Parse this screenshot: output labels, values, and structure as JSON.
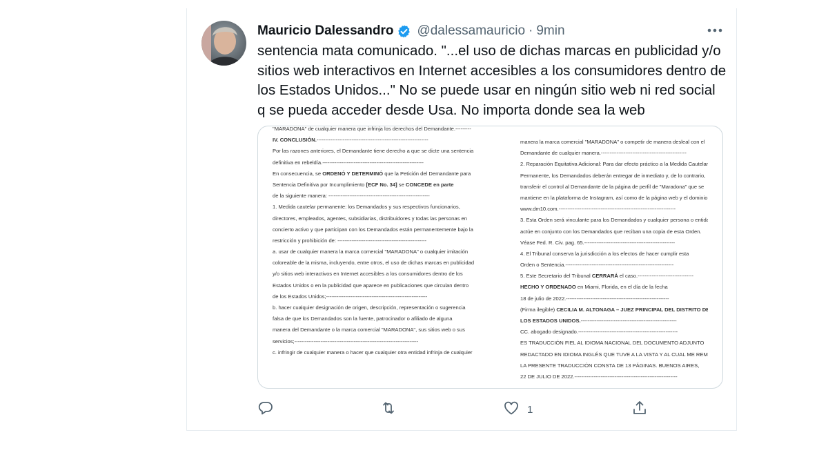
{
  "tweet": {
    "author_name": "Mauricio Dalessandro",
    "handle": "@dalessamauricio",
    "separator": "·",
    "time": "9min",
    "text": "sentencia mata comunicado. \"...el uso de dichas marcas en publicidad y/o sitios web interactivos en Internet accesibles a los consumidores dentro de los Estados Unidos...\" No se puede usar en ningún sitio web ni red social q se pueda acceder desde Usa. No importa donde sea la web",
    "likes": "1"
  },
  "icons": {
    "verified": "verified-badge-icon",
    "more": "more-dots-icon",
    "reply": "reply-icon",
    "retweet": "retweet-icon",
    "like": "heart-icon",
    "share": "share-icon"
  },
  "colors": {
    "verified": "#1d9bf0",
    "muted": "#536471",
    "border": "#cfd9de"
  },
  "document": {
    "left": [
      "\"MARADONA\" de cualquier manera que infrinja los derechos del Demandante.---------",
      "IV. CONCLUSIÓN.----------------------------------------------------------------",
      "Por las razones anteriores, el Demandante tiene derecho a que se dicte una sentencia",
      "definitiva en rebeldía.----------------------------------------------------------",
      "En consecuencia, se ORDENÓ Y DETERMINÓ que la Petición del Demandante para",
      "Sentencia Definitiva por Incumplimiento [ECF No. 34] se CONCEDE en parte",
      "de la siguiente manera: ----------------------------------------------------------",
      "1. Medida cautelar permanente: los Demandados y sus respectivos funcionarios,",
      "directores, empleados, agentes, subsidiarias, distribuidores y todas las personas en",
      "concierto activo y que participan con los Demandados están permanentemente bajo la",
      "restricción y prohibición de: ---------------------------------------------------",
      "a. usar de cualquier manera la marca comercial \"MARADONA\" o cualquier imitación",
      "coloreable de la misma, incluyendo, entre otros, el uso de dichas marcas en publicidad",
      "y/o sitios web interactivos en Internet accesibles a los consumidores dentro de los",
      "Estados Unidos o en la publicidad que aparece en publicaciones que circulan dentro",
      "de los Estados Unidos;----------------------------------------------------------",
      "b. hacer cualquier designación de origen, descripción, representación o sugerencia",
      "falsa de que los Demandados son la fuente, patrocinador o afiliado de alguna",
      "manera del Demandante o la marca comercial \"MARADONA\", sus sitios web o sus",
      "servicios;-----------------------------------------------------------------------",
      "c. infringir de cualquier manera o hacer que cualquier otra entidad infrinja de cualquier"
    ],
    "right": [
      "manera la marca comercial \"MARADONA\" o competir de manera desleal con el",
      "Demandante de cualquier manera.-------------------------------------------------",
      "2. Reparación Equitativa Adicional: Para dar efecto práctico a la Medida Cautelar",
      "Permanente, los Demandados deberán entregar de inmediato y, de lo contrario,",
      "transferir el control al Demandante de la página de perfil de \"Maradona\" que se",
      "mantiene en la plataforma de Instagram, así como de la página web y el dominio,",
      "www.dm10.com.-------------------------------------------------------------------",
      "3. Esta Orden será vinculante para los Demandados y cualquier persona o entidad que",
      "actúe en conjunto con los Demandados que reciban una copia de esta Orden.",
      "Véase Fed. R. Civ. pag. 65.----------------------------------------------------",
      "4. El Tribunal conserva la jurisdicción a los efectos de hacer cumplir esta",
      "Orden o Sentencia.--------------------------------------------------------------",
      "5. Este Secretario del Tribunal CERRARÁ el caso.--------------------------------",
      "HECHO Y ORDENADO en Miami, Florida, en el día de la fecha",
      "18 de julio de 2022.-----------------------------------------------------------",
      "(Firma ilegible) CECILIA M. ALTONAGA – JUEZ PRINCIPAL DEL DISTRITO DE",
      "LOS ESTADOS UNIDOS.-------------------------------------------------------",
      "CC. abogado designado.---------------------------------------------------------",
      "ES TRADUCCIÓN FIEL AL IDIOMA NACIONAL DEL DOCUMENTO ADJUNTO",
      "REDACTADO EN IDIOMA INGLÉS QUE TUVE A LA VISTA Y AL CUAL ME REMITO.",
      "LA PRESENTE TRADUCCIÓN CONSTA DE 13 PÁGINAS. BUENOS AIRES,",
      "22 DE JULIO DE 2022.-----------------------------------------------------------"
    ]
  }
}
